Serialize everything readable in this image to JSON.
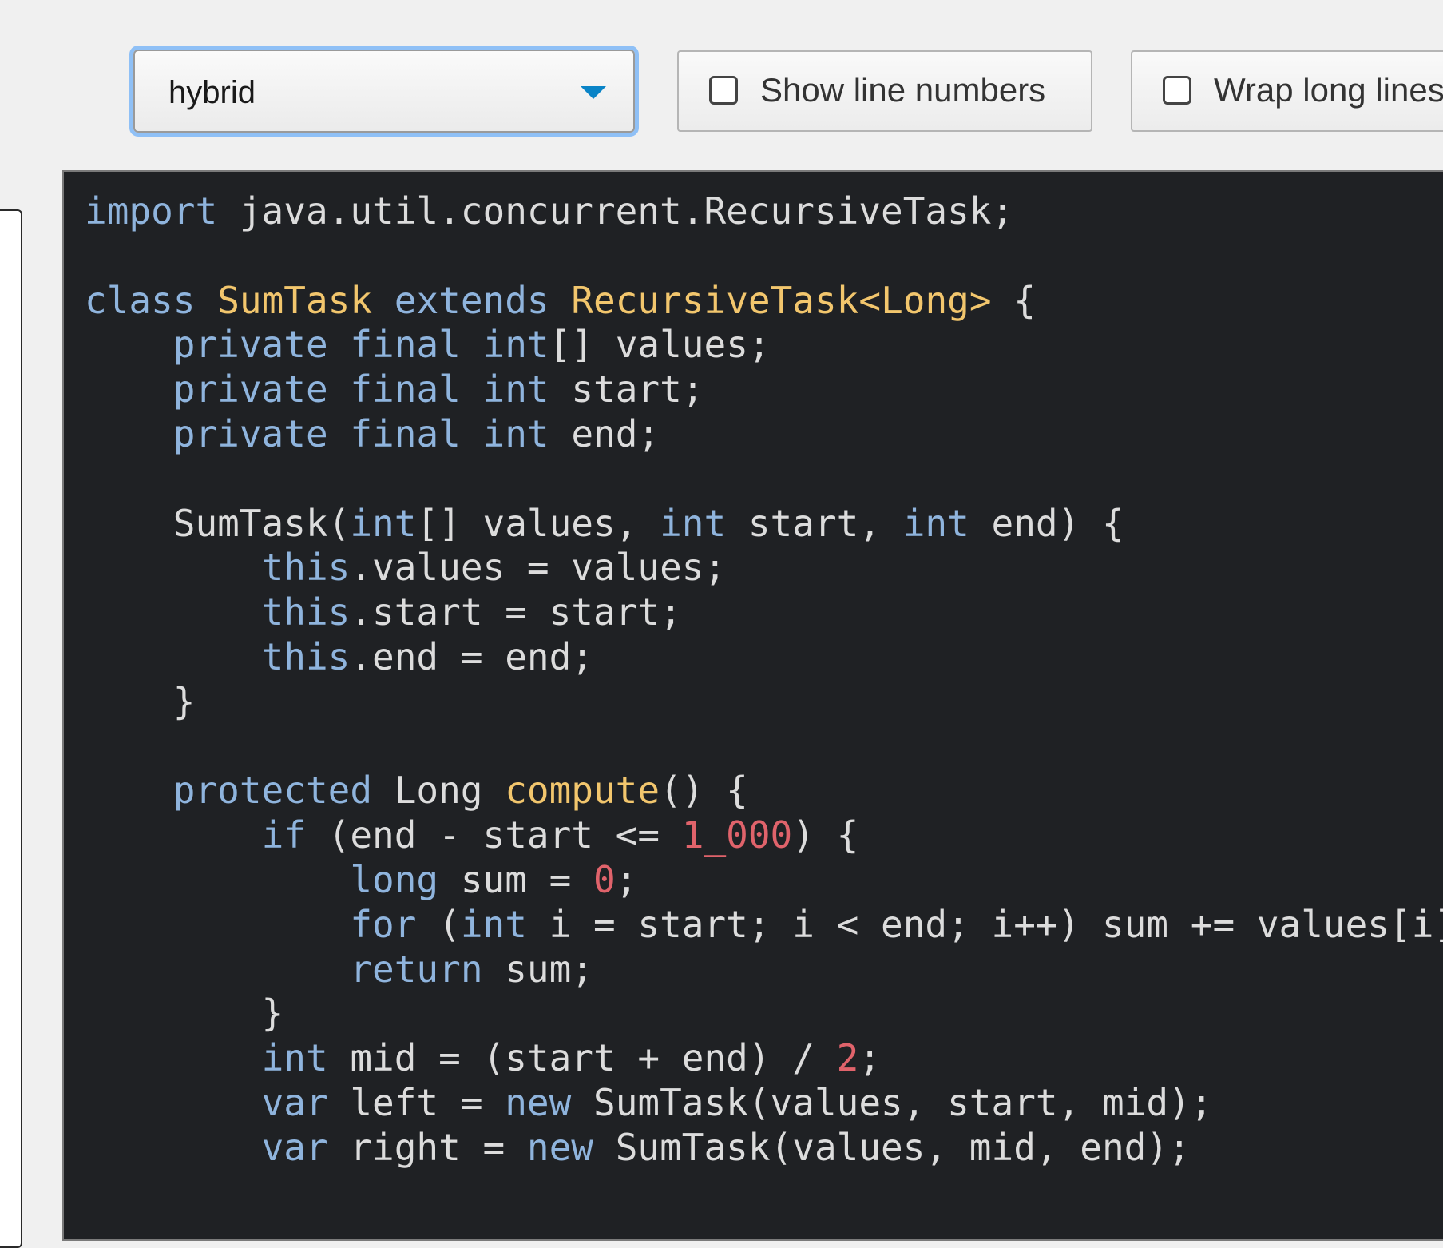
{
  "toolbar": {
    "mode_select": {
      "value": "hybrid"
    },
    "line_numbers": {
      "label": "Show line numbers",
      "checked": false
    },
    "wrap_lines": {
      "label": "Wrap long lines",
      "checked": false
    }
  },
  "colors": {
    "keyword": "#8fb4dd",
    "class_name": "#f2c66d",
    "function_name": "#f2c66d",
    "number": "#e0636b",
    "text": "#dcdcdc",
    "code_background": "#1f2124",
    "focus_ring": "#8fc0f6",
    "select_arrow": "#0a84c7"
  },
  "code": {
    "language": "java",
    "lines": [
      [
        [
          "kw",
          "import"
        ],
        [
          "txt",
          " java.util.concurrent.RecursiveTask;"
        ]
      ],
      [],
      [
        [
          "kw",
          "class"
        ],
        [
          "txt",
          " "
        ],
        [
          "cls",
          "SumTask"
        ],
        [
          "txt",
          " "
        ],
        [
          "kw",
          "extends"
        ],
        [
          "txt",
          " "
        ],
        [
          "cls",
          "RecursiveTask<Long>"
        ],
        [
          "txt",
          " {"
        ]
      ],
      [
        [
          "txt",
          "    "
        ],
        [
          "kw",
          "private"
        ],
        [
          "txt",
          " "
        ],
        [
          "kw",
          "final"
        ],
        [
          "txt",
          " "
        ],
        [
          "kw",
          "int"
        ],
        [
          "txt",
          "[] values;"
        ]
      ],
      [
        [
          "txt",
          "    "
        ],
        [
          "kw",
          "private"
        ],
        [
          "txt",
          " "
        ],
        [
          "kw",
          "final"
        ],
        [
          "txt",
          " "
        ],
        [
          "kw",
          "int"
        ],
        [
          "txt",
          " start;"
        ]
      ],
      [
        [
          "txt",
          "    "
        ],
        [
          "kw",
          "private"
        ],
        [
          "txt",
          " "
        ],
        [
          "kw",
          "final"
        ],
        [
          "txt",
          " "
        ],
        [
          "kw",
          "int"
        ],
        [
          "txt",
          " end;"
        ]
      ],
      [],
      [
        [
          "txt",
          "    SumTask("
        ],
        [
          "kw",
          "int"
        ],
        [
          "txt",
          "[] values, "
        ],
        [
          "kw",
          "int"
        ],
        [
          "txt",
          " start, "
        ],
        [
          "kw",
          "int"
        ],
        [
          "txt",
          " end) {"
        ]
      ],
      [
        [
          "txt",
          "        "
        ],
        [
          "kw",
          "this"
        ],
        [
          "txt",
          ".values = values;"
        ]
      ],
      [
        [
          "txt",
          "        "
        ],
        [
          "kw",
          "this"
        ],
        [
          "txt",
          ".start = start;"
        ]
      ],
      [
        [
          "txt",
          "        "
        ],
        [
          "kw",
          "this"
        ],
        [
          "txt",
          ".end = end;"
        ]
      ],
      [
        [
          "txt",
          "    }"
        ]
      ],
      [],
      [
        [
          "txt",
          "    "
        ],
        [
          "kw",
          "protected"
        ],
        [
          "txt",
          " Long "
        ],
        [
          "fn",
          "compute"
        ],
        [
          "txt",
          "() {"
        ]
      ],
      [
        [
          "txt",
          "        "
        ],
        [
          "kw",
          "if"
        ],
        [
          "txt",
          " (end - start <= "
        ],
        [
          "num",
          "1_000"
        ],
        [
          "txt",
          ") {"
        ]
      ],
      [
        [
          "txt",
          "            "
        ],
        [
          "kw",
          "long"
        ],
        [
          "txt",
          " sum = "
        ],
        [
          "num",
          "0"
        ],
        [
          "txt",
          ";"
        ]
      ],
      [
        [
          "txt",
          "            "
        ],
        [
          "kw",
          "for"
        ],
        [
          "txt",
          " ("
        ],
        [
          "kw",
          "int"
        ],
        [
          "txt",
          " i = start; i < end; i++) sum += values[i];"
        ]
      ],
      [
        [
          "txt",
          "            "
        ],
        [
          "kw",
          "return"
        ],
        [
          "txt",
          " sum;"
        ]
      ],
      [
        [
          "txt",
          "        }"
        ]
      ],
      [
        [
          "txt",
          "        "
        ],
        [
          "kw",
          "int"
        ],
        [
          "txt",
          " mid = (start + end) / "
        ],
        [
          "num",
          "2"
        ],
        [
          "txt",
          ";"
        ]
      ],
      [
        [
          "txt",
          "        "
        ],
        [
          "kw",
          "var"
        ],
        [
          "txt",
          " left = "
        ],
        [
          "kw",
          "new"
        ],
        [
          "txt",
          " SumTask(values, start, mid);"
        ]
      ],
      [
        [
          "txt",
          "        "
        ],
        [
          "kw",
          "var"
        ],
        [
          "txt",
          " right = "
        ],
        [
          "kw",
          "new"
        ],
        [
          "txt",
          " SumTask(values, mid, end);"
        ]
      ]
    ]
  }
}
